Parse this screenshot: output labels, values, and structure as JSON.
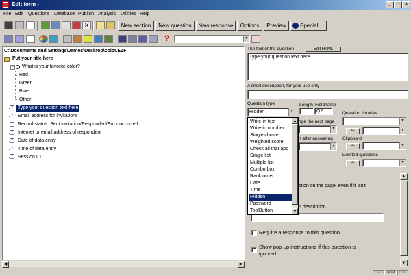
{
  "window": {
    "title": "Edit form -"
  },
  "menu": [
    "File",
    "Edit",
    "Questions",
    "Database",
    "Publish",
    "Analysis",
    "Utilities",
    "Help"
  ],
  "toolbar": {
    "new_section": "New section",
    "new_question": "New question",
    "new_response": "New response",
    "options": "Options",
    "preview": "Preview",
    "special": "Special..."
  },
  "tree": {
    "path": "C:\\Documents and Settings\\James\\Desktop\\color.EZF",
    "root": "Put your title here",
    "question": "What is your favorite color?",
    "responses": [
      "Red",
      "Green",
      "Blue",
      "Other"
    ],
    "items": [
      "Type your question text here",
      "Email address for invitations",
      "Record status: Sent invitation/Responded/Error occurred",
      "Internet or email address of respondent",
      "Date of data entry",
      "Time of data entry",
      "Session ID"
    ]
  },
  "editor": {
    "text_label": "The text of the question",
    "edit_html": "Edit HTML",
    "question_text": "Type your question text here",
    "short_desc_label": "A short description, for your use only",
    "short_desc_value": "",
    "qtype_label": "Question type",
    "qtype_value": "Hidden",
    "length_label": "Length",
    "fieldname_label": "Fieldname",
    "fieldname_value": "Q2",
    "change_next_page": "nge the next page",
    "after_answering": "n after answering",
    "libraries_label": "Question libraries",
    "clipboard_label": "Clipboard",
    "deleted_label": "Deleted questions",
    "arrow_left": "<-",
    "same_page_text": "stion on the page, even if it isn't",
    "description_text": "n description",
    "require_label": "Require a response to this question",
    "popup_label": "Show pop-up instructions if this question is ignored"
  },
  "dropdown_options": [
    "Write-in text",
    "Write-in number",
    "Single choice",
    "Weighted score",
    "Check all that app",
    "Single list",
    "Multiple list",
    "Combo box",
    "Rank order",
    "Date",
    "Time",
    "Hidden",
    "Password",
    "ToolButton"
  ],
  "dropdown_selected": "Hidden",
  "status": [
    "CAPS",
    "NUM",
    "OVR"
  ]
}
